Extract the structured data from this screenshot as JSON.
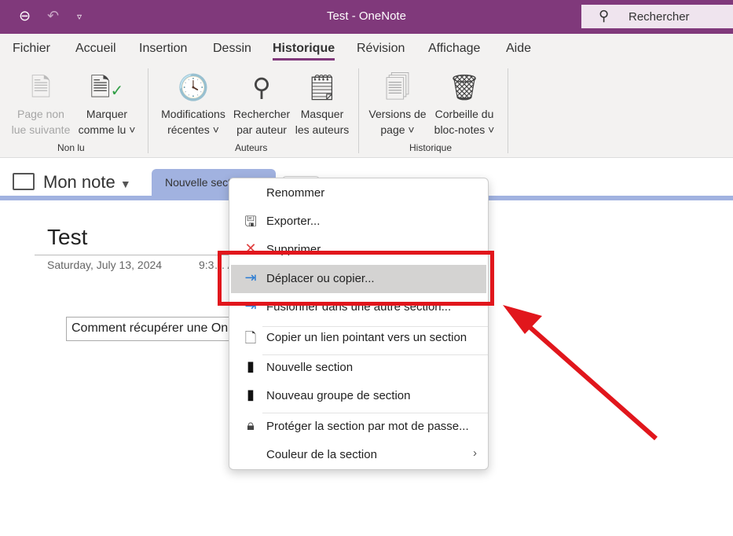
{
  "titlebar": {
    "title": "Test  -  OneNote",
    "search_placeholder": "Rechercher"
  },
  "tabs": [
    "Fichier",
    "Accueil",
    "Insertion",
    "Dessin",
    "Historique",
    "Révision",
    "Affichage",
    "Aide"
  ],
  "ribbon": {
    "buttons": [
      {
        "l1": "Page non",
        "l2": "lue suivante",
        "disabled": true
      },
      {
        "l1": "Marquer",
        "l2": "comme lu ˅"
      },
      {
        "l1": "Modifications",
        "l2": "récentes ˅"
      },
      {
        "l1": "Rechercher",
        "l2": "par auteur"
      },
      {
        "l1": "Masquer",
        "l2": "les auteurs"
      },
      {
        "l1": "Versions de",
        "l2": "page ˅"
      },
      {
        "l1": "Corbeille du",
        "l2": "bloc-notes ˅"
      }
    ],
    "groups": [
      "Non lu",
      "Auteurs",
      "Historique"
    ]
  },
  "notebook": {
    "name": "Mon note",
    "section_tab": "Nouvelle section"
  },
  "page": {
    "title": "Test",
    "date": "Saturday, July 13, 2024",
    "time": "9:3… A",
    "outline_text": "Comment récupérer une OneNote"
  },
  "menu": {
    "items": [
      "Renommer",
      "Exporter...",
      "Supprimer",
      "Déplacer ou copier...",
      "Fusionner dans une autre section...",
      "Copier un lien pointant vers un section",
      "Nouvelle section",
      "Nouveau groupe de section",
      "Protéger la section par mot de passe...",
      "Couleur de la section"
    ]
  },
  "colors": {
    "accent": "#80397b",
    "highlight": "#e1161c",
    "section": "#a1b2e0"
  }
}
